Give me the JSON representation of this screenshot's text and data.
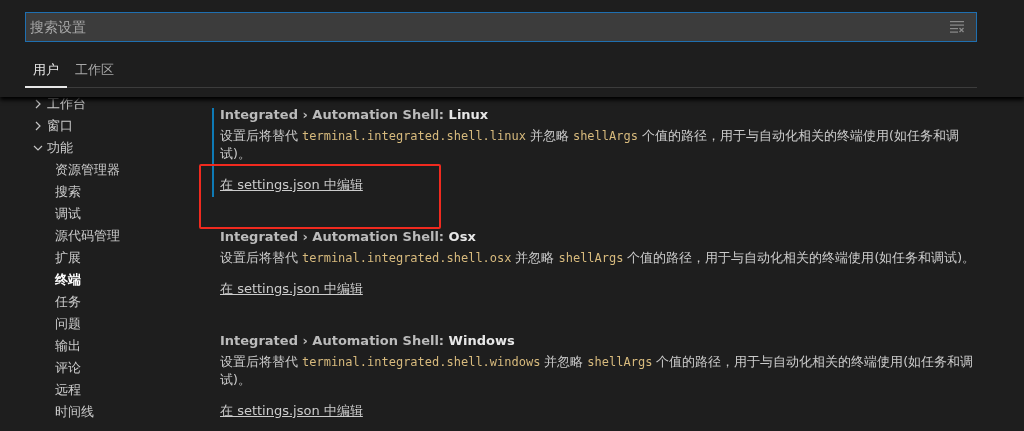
{
  "search": {
    "placeholder": "搜索设置"
  },
  "tabs": [
    {
      "label": "用户",
      "selected": true
    },
    {
      "label": "工作区",
      "selected": false
    }
  ],
  "sidebar": {
    "items": [
      {
        "label": "工作台",
        "expanded": false,
        "selected": false
      },
      {
        "label": "窗口",
        "expanded": false,
        "selected": false
      },
      {
        "label": "功能",
        "expanded": true,
        "selected": false,
        "children": [
          {
            "label": "资源管理器",
            "selected": false
          },
          {
            "label": "搜索",
            "selected": false
          },
          {
            "label": "调试",
            "selected": false
          },
          {
            "label": "源代码管理",
            "selected": false
          },
          {
            "label": "扩展",
            "selected": false
          },
          {
            "label": "终端",
            "selected": true
          },
          {
            "label": "任务",
            "selected": false
          },
          {
            "label": "问题",
            "selected": false
          },
          {
            "label": "输出",
            "selected": false
          },
          {
            "label": "评论",
            "selected": false
          },
          {
            "label": "远程",
            "selected": false
          },
          {
            "label": "时间线",
            "selected": false
          }
        ]
      }
    ]
  },
  "settings": [
    {
      "title": "Integrated › Automation Shell: **Linux**",
      "focused": true,
      "highlighted": true,
      "description": [
        {
          "kind": "text",
          "text": "设置后将替代 "
        },
        {
          "kind": "code",
          "text": "terminal.integrated.shell.linux"
        },
        {
          "kind": "text",
          "text": " 并忽略 "
        },
        {
          "kind": "code",
          "text": "shellArgs"
        },
        {
          "kind": "text",
          "text": " 个值的路径，用于与自动化相关的终端使用(如任务和调试)。"
        }
      ],
      "link": "在 settings.json 中编辑"
    },
    {
      "title": "Integrated › Automation Shell: **Osx**",
      "focused": false,
      "highlighted": false,
      "description": [
        {
          "kind": "text",
          "text": "设置后将替代 "
        },
        {
          "kind": "code",
          "text": "terminal.integrated.shell.osx"
        },
        {
          "kind": "text",
          "text": " 并忽略 "
        },
        {
          "kind": "code",
          "text": "shellArgs"
        },
        {
          "kind": "text",
          "text": " 个值的路径，用于与自动化相关的终端使用(如任务和调试)。"
        }
      ],
      "link": "在 settings.json 中编辑"
    },
    {
      "title": "Integrated › Automation Shell: **Windows**",
      "focused": false,
      "highlighted": false,
      "description": [
        {
          "kind": "text",
          "text": "设置后将替代 "
        },
        {
          "kind": "code",
          "text": "terminal.integrated.shell.windows"
        },
        {
          "kind": "text",
          "text": " 并忽略 "
        },
        {
          "kind": "code",
          "text": "shellArgs"
        },
        {
          "kind": "text",
          "text": " 个值的路径，用于与自动化相关的终端使用(如任务和调试)。"
        }
      ],
      "link": "在 settings.json 中编辑"
    }
  ]
}
